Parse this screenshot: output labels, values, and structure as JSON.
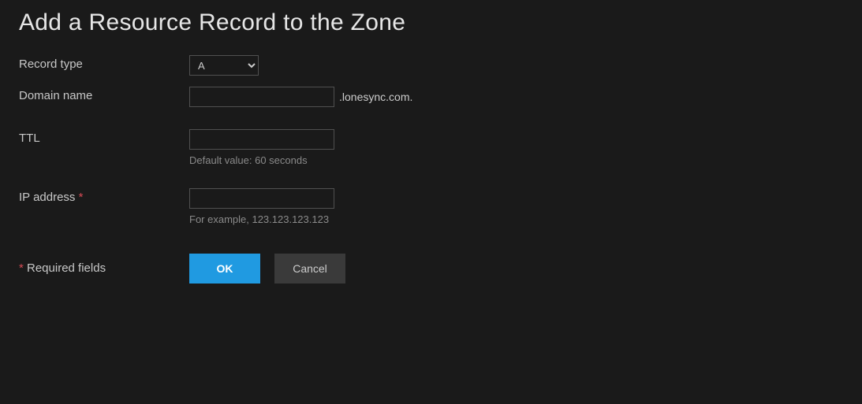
{
  "title": "Add a Resource Record to the Zone",
  "fields": {
    "record_type": {
      "label": "Record type",
      "value": "A"
    },
    "domain_name": {
      "label": "Domain name",
      "value": "",
      "suffix": ".lonesync.com."
    },
    "ttl": {
      "label": "TTL",
      "value": "",
      "hint": "Default value: 60 seconds"
    },
    "ip_address": {
      "label": "IP address",
      "required_mark": "*",
      "value": "",
      "hint": "For example, 123.123.123.123"
    }
  },
  "required_note": {
    "mark": "*",
    "text": " Required fields"
  },
  "buttons": {
    "ok": "OK",
    "cancel": "Cancel"
  }
}
